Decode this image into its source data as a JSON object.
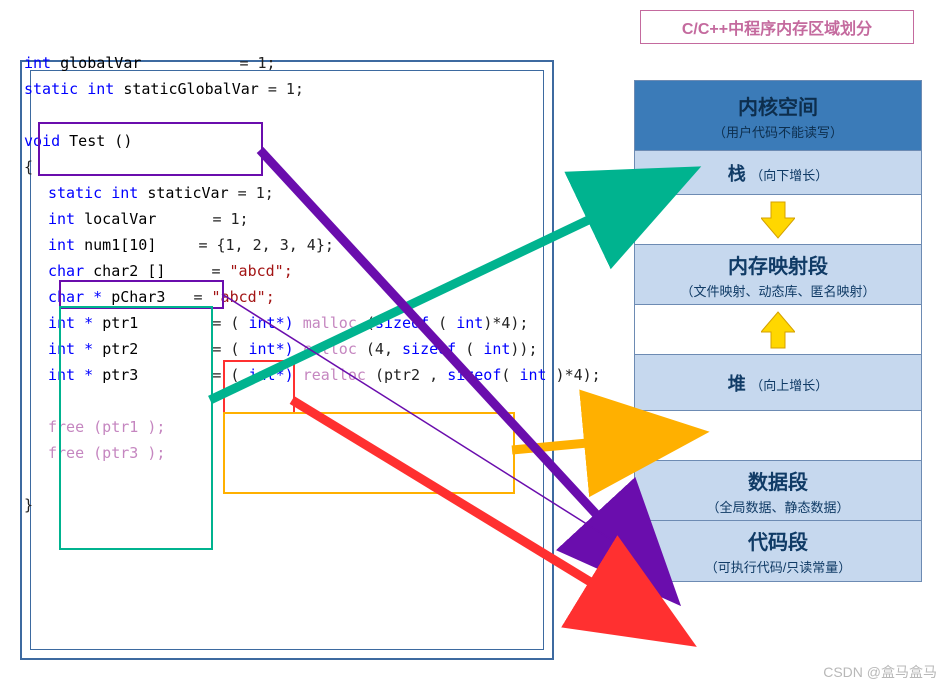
{
  "title": "C/C++中程序内存区域划分",
  "code": {
    "globalVar_decl_kw": "int",
    "globalVar_name": "globalVar",
    "globalVar_eq": "= 1;",
    "staticGlobal_kw": "static int",
    "staticGlobal_name": "staticGlobalVar",
    "staticGlobal_eq": "= 1;",
    "void_kw": "void",
    "test_fn": "Test ()",
    "brace_open": "{",
    "staticVar_kw": "static int",
    "staticVar_name": "staticVar",
    "staticVar_eq": "= 1;",
    "localVar_kw": "int",
    "localVar_name": "localVar",
    "localVar_eq": "= 1;",
    "num1_kw": "int",
    "num1_name": "num1[10]",
    "num1_eq": "= {1, 2, 3, 4};",
    "char2_kw": "char",
    "char2_name": "char2 []",
    "char2_eq": "=",
    "char2_str": "\"abcd\";",
    "pChar3_kw": "char *",
    "pChar3_name": "pChar3",
    "pChar3_eq": "=",
    "pChar3_str": "\"abcd\";",
    "ptr1_kw": "int *",
    "ptr1_name": "ptr1",
    "ptr1_eq": "= (",
    "ptr1_cast": " int*)",
    "ptr1_fn": "malloc",
    "ptr1_args_a": "(",
    "ptr1_sizeof": "sizeof",
    "ptr1_args_b": " ( ",
    "ptr1_int": "int",
    "ptr1_args_c": ")*4);",
    "ptr2_kw": "int *",
    "ptr2_name": "ptr2",
    "ptr2_eq": "= (",
    "ptr2_cast": " int*)",
    "ptr2_fn": "calloc",
    "ptr2_args_a": "(4, ",
    "ptr2_sizeof": "sizeof",
    "ptr2_args_b": " ( ",
    "ptr2_int": "int",
    "ptr2_args_c": "));",
    "ptr3_kw": "int *",
    "ptr3_name": "ptr3",
    "ptr3_eq": "= (",
    "ptr3_cast": " int*)",
    "ptr3_fn": "realloc",
    "ptr3_args_a": "(ptr2 , ",
    "ptr3_sizeof": "sizeof",
    "ptr3_args_b": "( ",
    "ptr3_int": "int",
    "ptr3_args_c": " )*4);",
    "free1": "free (ptr1 );",
    "free3": "free (ptr3 );",
    "brace_close": "}"
  },
  "mem": {
    "kernel_t": "内核空间",
    "kernel_s": "（用户代码不能读写）",
    "stack_t": "栈",
    "stack_s": "（向下增长）",
    "mmap_t": "内存映射段",
    "mmap_s": "（文件映射、动态库、匿名映射）",
    "heap_t": "堆",
    "heap_s": "（向上增长）",
    "data_t": "数据段",
    "data_s": "（全局数据、静态数据）",
    "code_t": "代码段",
    "code_s": "（可执行代码/只读常量）"
  },
  "watermark": "CSDN @盒马盒马"
}
